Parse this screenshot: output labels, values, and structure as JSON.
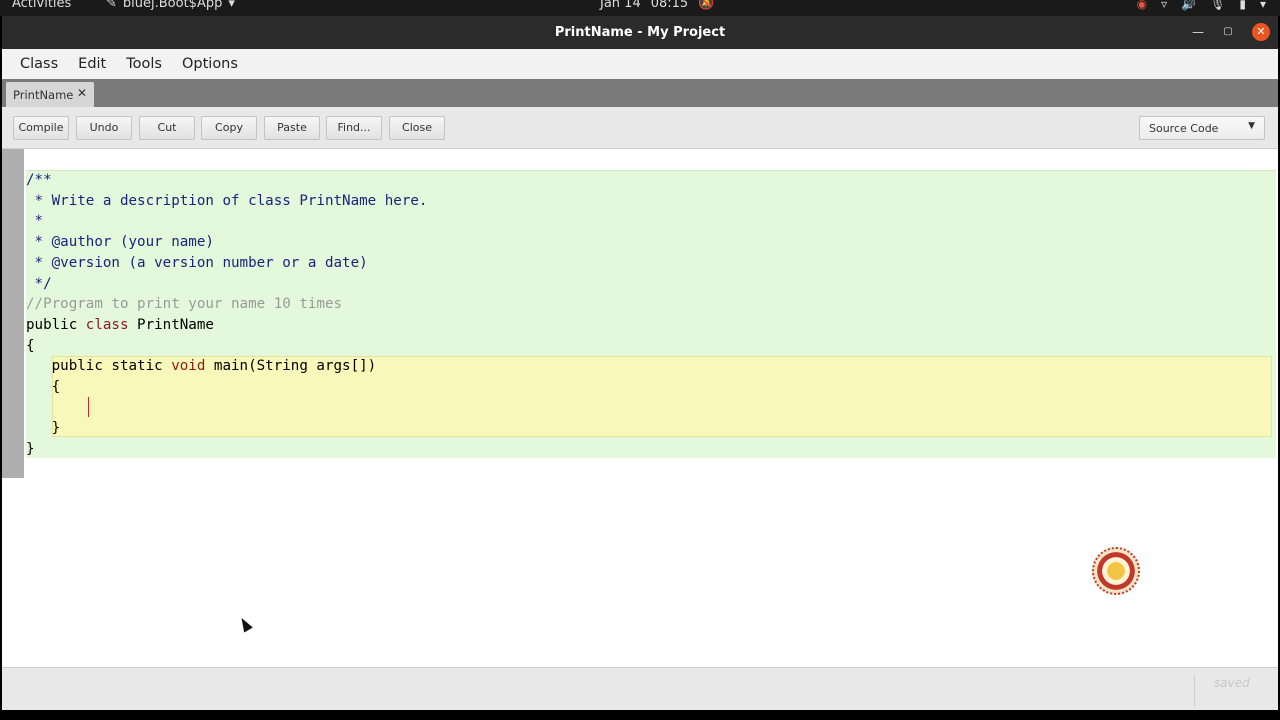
{
  "topbar": {
    "activities": "Activities",
    "app_name": "bluej.Boot$App",
    "date": "Jan 14",
    "time": "08:15"
  },
  "window": {
    "title": "PrintName - My Project"
  },
  "menu": {
    "items": [
      "Class",
      "Edit",
      "Tools",
      "Options"
    ]
  },
  "tabs": [
    {
      "label": "PrintName"
    }
  ],
  "toolbar": {
    "buttons": [
      "Compile",
      "Undo",
      "Cut",
      "Copy",
      "Paste",
      "Find...",
      "Close"
    ],
    "view_select": "Source Code"
  },
  "code": {
    "lines": [
      "/**",
      " * Write a description of class PrintName here.",
      " *",
      " * @author (your name)",
      " * @version (a version number or a date)",
      " */",
      "//Program to print your name 10 times",
      "public class PrintName",
      "{",
      "   public static void main(String args[])",
      "   {",
      "",
      "   }",
      "}"
    ]
  },
  "status": {
    "text": "saved"
  },
  "colors": {
    "class_scope": "#e4f8dc",
    "method_scope": "#f7f8ba",
    "keyword": "#8b1a1a",
    "doc_comment": "#1a237e",
    "close_button": "#e95420"
  }
}
